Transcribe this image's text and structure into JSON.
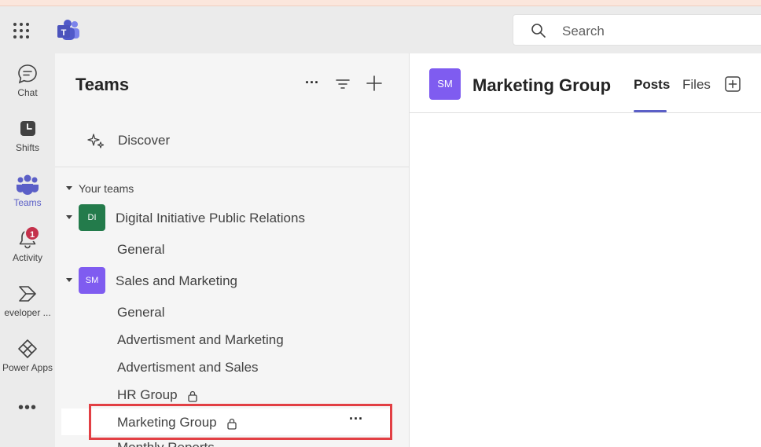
{
  "titlebar": {
    "search_placeholder": "Search"
  },
  "rail": {
    "items": [
      {
        "label": "Chat",
        "icon": "chat-icon"
      },
      {
        "label": "Shifts",
        "icon": "shifts-icon"
      },
      {
        "label": "Teams",
        "icon": "teams-icon",
        "active": true
      },
      {
        "label": "Activity",
        "icon": "bell-icon",
        "badge": "1"
      },
      {
        "label": "eveloper ...",
        "icon": "developer-portal-icon"
      },
      {
        "label": "Power Apps",
        "icon": "power-apps-icon"
      }
    ],
    "more_label": "•••"
  },
  "panel": {
    "title": "Teams",
    "more_label": "···",
    "discover_label": "Discover",
    "section_label": "Your teams",
    "teams": [
      {
        "initials": "DI",
        "name": "Digital Initiative Public Relations",
        "color": "#237b4b",
        "channels": [
          "General"
        ]
      },
      {
        "initials": "SM",
        "name": "Sales and Marketing",
        "color": "#7f5cf0",
        "channels": [
          "General",
          "Advertisment and Marketing",
          "Advertisment and Sales",
          "HR Group",
          "Marketing Group",
          "Monthly Reports"
        ]
      }
    ],
    "selected_more_label": "···"
  },
  "content": {
    "avatar_initials": "SM",
    "title": "Marketing Group",
    "tabs": [
      "Posts",
      "Files"
    ]
  },
  "colors": {
    "accent": "#5b5fc7",
    "highlight": "#e23f44",
    "badge": "#c4314b"
  }
}
